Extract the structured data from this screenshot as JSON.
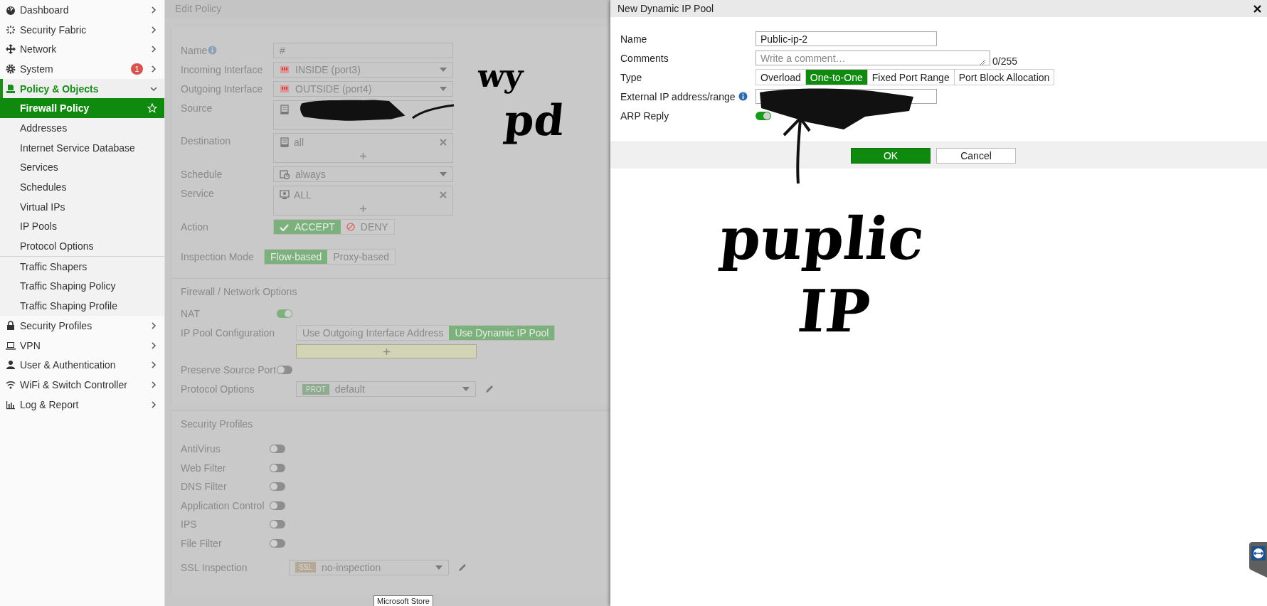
{
  "sidebar": {
    "items": [
      {
        "label": "Dashboard",
        "active": false,
        "expanded": false
      },
      {
        "label": "Security Fabric",
        "active": false,
        "expanded": false
      },
      {
        "label": "Network",
        "active": false,
        "expanded": false
      },
      {
        "label": "System",
        "active": false,
        "expanded": false,
        "badge": "1"
      },
      {
        "label": "Policy & Objects",
        "active": true,
        "expanded": true,
        "children": [
          {
            "label": "Firewall Policy",
            "selected": true,
            "divider_before": false
          },
          {
            "label": "Addresses",
            "selected": false,
            "divider_before": false
          },
          {
            "label": "Internet Service Database",
            "selected": false,
            "divider_before": false
          },
          {
            "label": "Services",
            "selected": false,
            "divider_before": false
          },
          {
            "label": "Schedules",
            "selected": false,
            "divider_before": false
          },
          {
            "label": "Virtual IPs",
            "selected": false,
            "divider_before": false
          },
          {
            "label": "IP Pools",
            "selected": false,
            "divider_before": false
          },
          {
            "label": "Protocol Options",
            "selected": false,
            "divider_before": false
          },
          {
            "label": "Traffic Shapers",
            "selected": false,
            "divider_before": true
          },
          {
            "label": "Traffic Shaping Policy",
            "selected": false,
            "divider_before": false
          },
          {
            "label": "Traffic Shaping Profile",
            "selected": false,
            "divider_before": false
          }
        ]
      },
      {
        "label": "Security Profiles",
        "active": false,
        "expanded": false
      },
      {
        "label": "VPN",
        "active": false,
        "expanded": false
      },
      {
        "label": "User & Authentication",
        "active": false,
        "expanded": false
      },
      {
        "label": "WiFi & Switch Controller",
        "active": false,
        "expanded": false
      },
      {
        "label": "Log & Report",
        "active": false,
        "expanded": false
      }
    ]
  },
  "edit_policy": {
    "title": "Edit Policy",
    "sections": [
      {
        "rows": [
          {
            "kind": "text",
            "label": "Name",
            "info": true,
            "value": "#"
          },
          {
            "kind": "interface",
            "label": "Incoming Interface",
            "value": "INSIDE (port3)"
          },
          {
            "kind": "interface",
            "label": "Outgoing Interface",
            "value": "OUTSIDE (port4)"
          },
          {
            "kind": "address",
            "label": "Source",
            "redacted": true
          },
          {
            "kind": "address",
            "label": "Destination",
            "value": "all"
          },
          {
            "kind": "schedule",
            "label": "Schedule",
            "value": "always"
          },
          {
            "kind": "service",
            "label": "Service",
            "value": "ALL"
          },
          {
            "kind": "action",
            "label": "Action",
            "options": [
              {
                "label": "ACCEPT",
                "selected": true
              },
              {
                "label": "DENY",
                "selected": false
              }
            ]
          },
          {
            "kind": "mode",
            "label": "Inspection Mode",
            "options": [
              {
                "label": "Flow-based",
                "selected": true
              },
              {
                "label": "Proxy-based",
                "selected": false
              }
            ]
          }
        ]
      },
      {
        "title": "Firewall / Network Options",
        "rows": [
          {
            "kind": "toggle",
            "label": "NAT",
            "on": true
          },
          {
            "kind": "mode",
            "label": "IP Pool Configuration",
            "add_bar": true,
            "options": [
              {
                "label": "Use Outgoing Interface Address",
                "selected": false
              },
              {
                "label": "Use Dynamic IP Pool",
                "selected": true
              }
            ]
          },
          {
            "kind": "toggle",
            "label": "Preserve Source Port",
            "on": false
          },
          {
            "kind": "profile",
            "label": "Protocol Options",
            "tag": "PROT",
            "value": "default"
          }
        ]
      },
      {
        "title": "Security Profiles",
        "rows": [
          {
            "kind": "toggle",
            "label": "AntiVirus",
            "on": false
          },
          {
            "kind": "toggle",
            "label": "Web Filter",
            "on": false
          },
          {
            "kind": "toggle",
            "label": "DNS Filter",
            "on": false
          },
          {
            "kind": "toggle",
            "label": "Application Control",
            "on": false
          },
          {
            "kind": "toggle",
            "label": "IPS",
            "on": false
          },
          {
            "kind": "toggle",
            "label": "File Filter",
            "on": false
          },
          {
            "kind": "profile",
            "label": "SSL Inspection",
            "tag": "SSL",
            "value": "no-inspection"
          }
        ]
      }
    ]
  },
  "dialog": {
    "title": "New Dynamic IP Pool",
    "rows": [
      {
        "kind": "text",
        "label": "Name",
        "value": "Public-ip-2"
      },
      {
        "kind": "textarea",
        "label": "Comments",
        "placeholder": "Write a comment…",
        "counter": "0/255"
      },
      {
        "kind": "segmented",
        "label": "Type",
        "options": [
          {
            "label": "Overload",
            "selected": false
          },
          {
            "label": "One-to-One",
            "selected": true
          },
          {
            "label": "Fixed Port Range",
            "selected": false
          },
          {
            "label": "Port Block Allocation",
            "selected": false
          }
        ]
      },
      {
        "kind": "text",
        "label": "External IP address/range",
        "info": true,
        "redacted": true
      },
      {
        "kind": "toggle",
        "label": "ARP Reply",
        "on": true
      }
    ],
    "buttons": [
      {
        "label": "OK",
        "primary": true
      },
      {
        "label": "Cancel",
        "primary": false
      }
    ]
  },
  "annotations": [
    {
      "text": "wy"
    },
    {
      "text": "pd"
    },
    {
      "text": "puplic"
    },
    {
      "text": "IP"
    }
  ],
  "tooltip": {
    "text": "Microsoft Store"
  }
}
